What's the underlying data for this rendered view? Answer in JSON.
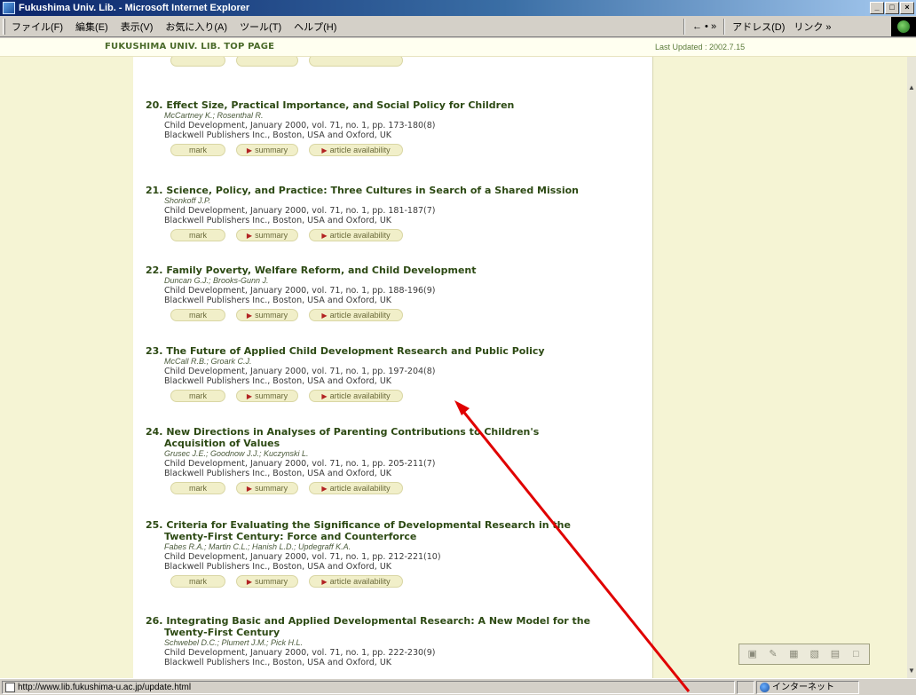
{
  "window": {
    "title": "Fukushima Univ. Lib. - Microsoft Internet Explorer",
    "buttons": [
      "_",
      "□",
      "×"
    ]
  },
  "menu": {
    "items": [
      "ファイル(F)",
      "編集(E)",
      "表示(V)",
      "お気に入り(A)",
      "ツール(T)",
      "ヘルプ(H)"
    ],
    "back": "← • »",
    "address": "アドレス(D)",
    "links": "リンク »"
  },
  "header": {
    "top_link": "FUKUSHIMA UNIV. LIB. TOP PAGE",
    "updated": "Last Updated : 2002.7.15"
  },
  "buttons": {
    "mark": "mark",
    "summary": "summary",
    "availability": "article availability"
  },
  "articles": [
    {
      "num": "20.",
      "title": "Effect Size, Practical Importance, and Social Policy for Children",
      "title_cont": "",
      "authors": "McCartney K.; Rosenthal R.",
      "citation": "Child Development, January 2000, vol. 71, no. 1, pp. 173-180(8)",
      "publisher": "Blackwell Publishers Inc., Boston, USA and Oxford, UK"
    },
    {
      "num": "21.",
      "title": "Science, Policy, and Practice: Three Cultures in Search of a Shared Mission",
      "title_cont": "",
      "authors": "Shonkoff J.P.",
      "citation": "Child Development, January 2000, vol. 71, no. 1, pp. 181-187(7)",
      "publisher": "Blackwell Publishers Inc., Boston, USA and Oxford, UK"
    },
    {
      "num": "22.",
      "title": "Family Poverty, Welfare Reform, and Child Development",
      "title_cont": "",
      "authors": "Duncan G.J.; Brooks-Gunn J.",
      "citation": "Child Development, January 2000, vol. 71, no. 1, pp. 188-196(9)",
      "publisher": "Blackwell Publishers Inc., Boston, USA and Oxford, UK"
    },
    {
      "num": "23.",
      "title": "The Future of Applied Child Development Research and Public Policy",
      "title_cont": "",
      "authors": "McCall R.B.; Groark C.J.",
      "citation": "Child Development, January 2000, vol. 71, no. 1, pp. 197-204(8)",
      "publisher": "Blackwell Publishers Inc., Boston, USA and Oxford, UK"
    },
    {
      "num": "24.",
      "title": "New Directions in Analyses of Parenting Contributions to Children's",
      "title_cont": "Acquisition of Values",
      "authors": "Grusec J.E.; Goodnow J.J.; Kuczynski L.",
      "citation": "Child Development, January 2000, vol. 71, no. 1, pp. 205-211(7)",
      "publisher": "Blackwell Publishers Inc., Boston, USA and Oxford, UK"
    },
    {
      "num": "25.",
      "title": "Criteria for Evaluating the Significance of Developmental Research in the",
      "title_cont": "Twenty-First Century: Force and Counterforce",
      "authors": "Fabes R.A.; Martin C.L.; Hanish L.D.; Updegraff K.A.",
      "citation": "Child Development, January 2000, vol. 71, no. 1, pp. 212-221(10)",
      "publisher": "Blackwell Publishers Inc., Boston, USA and Oxford, UK"
    },
    {
      "num": "26.",
      "title": "Integrating Basic and Applied Developmental Research: A New Model for the",
      "title_cont": "Twenty-First Century",
      "authors": "Schwebel D.C.; Plumert J.M.; Pick H.L.",
      "citation": "Child Development, January 2000, vol. 71, no. 1, pp. 222-230(9)",
      "publisher": "Blackwell Publishers Inc., Boston, USA and Oxford, UK"
    }
  ],
  "status": {
    "url": "http://www.lib.fukushima-u.ac.jp/update.html",
    "zone": "インターネット"
  },
  "colors": {
    "pane_bg": "#f5f4d4",
    "title_green": "#2d4a14",
    "button_bg": "#f1efc9",
    "arrow_red": "#e00000"
  }
}
